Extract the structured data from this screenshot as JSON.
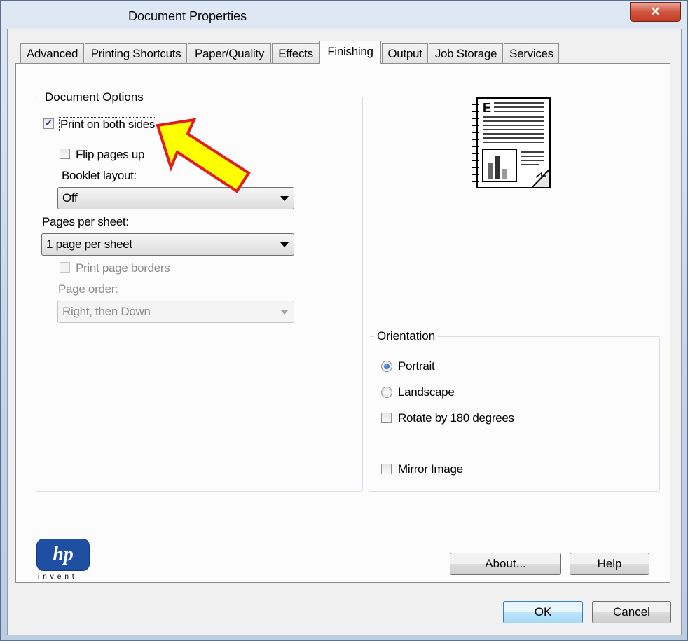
{
  "window": {
    "title": "Document Properties",
    "close_glyph": "✕"
  },
  "tabs": [
    {
      "label": "Advanced"
    },
    {
      "label": "Printing Shortcuts"
    },
    {
      "label": "Paper/Quality"
    },
    {
      "label": "Effects"
    },
    {
      "label": "Finishing",
      "active": true
    },
    {
      "label": "Output"
    },
    {
      "label": "Job Storage"
    },
    {
      "label": "Services"
    }
  ],
  "document_options": {
    "title": "Document Options",
    "print_both_sides": {
      "label": "Print on both sides",
      "checked": true
    },
    "flip_pages_up": {
      "label": "Flip pages up",
      "checked": false
    },
    "booklet_layout": {
      "label": "Booklet layout:",
      "value": "Off"
    },
    "pages_per_sheet": {
      "label": "Pages per sheet:",
      "value": "1 page per sheet"
    },
    "print_page_borders": {
      "label": "Print page borders",
      "checked": false
    },
    "page_order": {
      "label": "Page order:",
      "value": "Right, then Down"
    }
  },
  "orientation": {
    "title": "Orientation",
    "portrait": {
      "label": "Portrait",
      "selected": true
    },
    "landscape": {
      "label": "Landscape",
      "selected": false
    },
    "rotate_180": {
      "label": "Rotate by 180 degrees",
      "checked": false
    },
    "mirror_image": {
      "label": "Mirror Image",
      "checked": false
    }
  },
  "preview_icon": "duplex-document-preview-icon",
  "logo": {
    "mark": "hp",
    "tagline": "invent"
  },
  "buttons": {
    "about": "About...",
    "help": "Help",
    "ok": "OK",
    "cancel": "Cancel"
  },
  "colors": {
    "arrow_fill": "#ffff00",
    "arrow_stroke": "#e31b1b",
    "hp_blue": "#1f4fa3"
  }
}
